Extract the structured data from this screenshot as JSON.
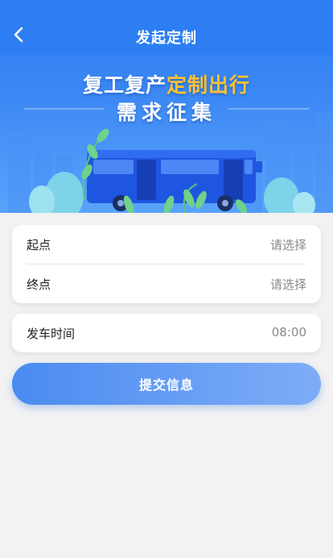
{
  "nav": {
    "title": "发起定制",
    "back_icon": "chevron-left-icon"
  },
  "banner": {
    "line1_part1": "复工复产",
    "line1_highlight": "定制出行",
    "line2": "需求征集",
    "highlight_color": "#ffc22d",
    "illustration": "bus-icon"
  },
  "form": {
    "start": {
      "label": "起点",
      "value": "请选择"
    },
    "end": {
      "label": "终点",
      "value": "请选择"
    },
    "departure_time": {
      "label": "发车时间",
      "value": "08:00"
    }
  },
  "submit": {
    "label": "提交信息"
  },
  "colors": {
    "primary": "#2d7ef2",
    "page_bg": "#f2f2f2",
    "button_start": "#4a8bf0",
    "button_end": "#7eadf7"
  }
}
